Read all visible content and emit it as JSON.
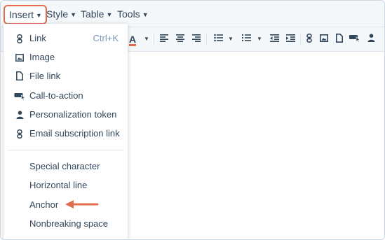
{
  "menubar": {
    "items": [
      {
        "label": "Insert"
      },
      {
        "label": "Style"
      },
      {
        "label": "Table"
      },
      {
        "label": "Tools"
      }
    ]
  },
  "dropdown": {
    "items": [
      {
        "label": "Link",
        "shortcut": "Ctrl+K",
        "icon": "link-icon"
      },
      {
        "label": "Image",
        "icon": "image-icon"
      },
      {
        "label": "File link",
        "icon": "file-icon"
      },
      {
        "label": "Call-to-action",
        "icon": "cta-icon"
      },
      {
        "label": "Personalization token",
        "icon": "person-icon"
      },
      {
        "label": "Email subscription link",
        "icon": "link-icon"
      }
    ],
    "more_items": [
      {
        "label": "Special character"
      },
      {
        "label": "Horizontal line"
      },
      {
        "label": "Anchor"
      },
      {
        "label": "Nonbreaking space"
      }
    ]
  },
  "toolbar": {
    "font_color_glyph": "A"
  },
  "colors": {
    "accent": "#e36c4c",
    "text": "#33475b",
    "toolbar_bg": "#f5f8fa"
  }
}
